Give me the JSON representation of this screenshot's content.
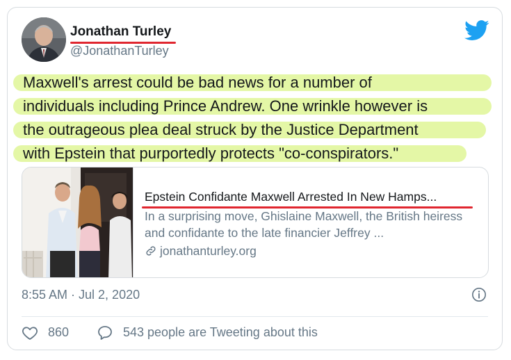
{
  "author": {
    "name": "Jonathan Turley",
    "handle": "@JonathanTurley"
  },
  "tweet": {
    "lines": [
      "Maxwell's arrest could be bad news for a number of",
      "individuals including Prince Andrew.  One wrinkle however is",
      "the outrageous plea deal struck by the Justice Department",
      "with Epstein that purportedly protects \"co-conspirators.\""
    ],
    "highlight_color": "#e4f7a6"
  },
  "link_card": {
    "title": "Epstein Confidante Maxwell Arrested In New Hamps...",
    "description": "In a surprising move, Ghislaine Maxwell, the British heiress and confidante to the late financier Jeffrey ...",
    "domain": "jonathanturley.org",
    "domain_icon": "link-icon"
  },
  "meta": {
    "timestamp": "8:55 AM · Jul 2, 2020"
  },
  "stats": {
    "likes": "860",
    "replies_text": "543 people are Tweeting about this"
  },
  "colors": {
    "underline": "#e0262f",
    "twitter_blue": "#1da1f2",
    "muted_text": "#657786"
  }
}
